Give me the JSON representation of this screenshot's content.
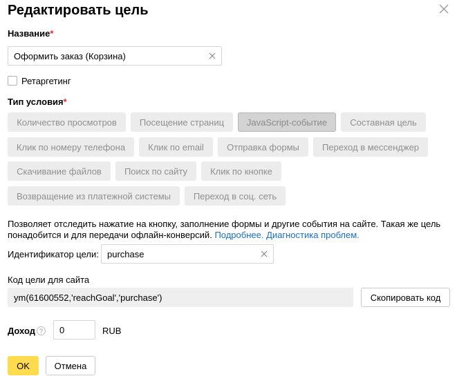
{
  "dialog": {
    "title": "Редактировать цель",
    "close_icon": "close-icon"
  },
  "name_field": {
    "label": "Название",
    "required_mark": "*",
    "value": "Оформить заказ (Корзина)"
  },
  "retargeting": {
    "label": "Ретаргетинг",
    "checked": false
  },
  "condition_type": {
    "label": "Тип условия",
    "required_mark": "*",
    "options": [
      "Количество просмотров",
      "Посещение страниц",
      "JavaScript-событие",
      "Составная цель",
      "Клик по номеру телефона",
      "Клик по email",
      "Отправка формы",
      "Переход в мессенджер",
      "Скачивание файлов",
      "Поиск по сайту",
      "Клик по кнопке",
      "Возвращение из платежной системы",
      "Переход в соц. сеть"
    ],
    "selected": "JavaScript-событие"
  },
  "description": {
    "text": "Позволяет отследить нажатие на кнопку, заполнение формы и другие события на сайте. Такая же цель понадобится и для передачи офлайн-конверсий.",
    "link_more": "Подробнее.",
    "link_diagnostics": "Диагностика проблем."
  },
  "goal_id": {
    "label": "Идентификатор цели:",
    "value": "purchase"
  },
  "site_code": {
    "label": "Код цели для сайта",
    "code": "ym(61600552,'reachGoal','purchase')",
    "copy_button": "Скопировать код"
  },
  "income": {
    "label": "Доход",
    "help_icon": "question-icon",
    "help_glyph": "?",
    "value": "0",
    "currency": "RUB"
  },
  "footer": {
    "ok_label": "OK",
    "cancel_label": "Отмена"
  },
  "colors": {
    "accent_yellow": "#ffdb4d",
    "required_red": "#e52b2b",
    "link_blue": "#1a6fc5",
    "chip_bg": "#ececec",
    "chip_selected_bg": "#d3d3d3"
  }
}
